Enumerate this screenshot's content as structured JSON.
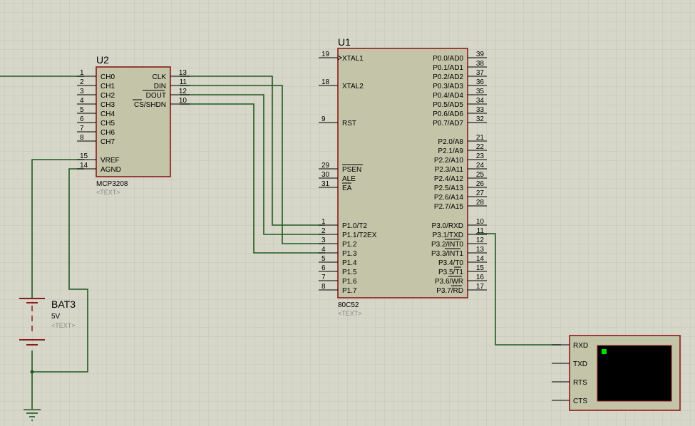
{
  "colors": {
    "background": "#d7d7c9",
    "grid": "#c6c6b8",
    "component_fill": "#c4c4a8",
    "component_border": "#8b1c1c",
    "wire": "#1f5a1f",
    "terminal_screen": "#000000",
    "terminal_led": "#00e000"
  },
  "u2": {
    "ref": "U2",
    "part": "MCP3208",
    "text_placeholder": "<TEXT>",
    "left_pins": [
      {
        "num": "1",
        "name": "CH0"
      },
      {
        "num": "2",
        "name": "CH1"
      },
      {
        "num": "3",
        "name": "CH2"
      },
      {
        "num": "4",
        "name": "CH3"
      },
      {
        "num": "5",
        "name": "CH4"
      },
      {
        "num": "6",
        "name": "CH5"
      },
      {
        "num": "7",
        "name": "CH6"
      },
      {
        "num": "8",
        "name": "CH7"
      },
      {
        "num": "15",
        "name": "VREF"
      },
      {
        "num": "14",
        "name": "AGND"
      }
    ],
    "right_pins": [
      {
        "num": "13",
        "name": "CLK"
      },
      {
        "num": "11",
        "name": "DIN"
      },
      {
        "num": "12",
        "name": "DOUT"
      },
      {
        "num": "10",
        "name": "CS/SHDN"
      }
    ]
  },
  "u1": {
    "ref": "U1",
    "part": "80C52",
    "text_placeholder": "<TEXT>",
    "left_pins": [
      {
        "num": "19",
        "name": "XTAL1"
      },
      {
        "num": "18",
        "name": "XTAL2"
      },
      {
        "num": "9",
        "name": "RST"
      },
      {
        "num": "29",
        "name": "PSEN"
      },
      {
        "num": "30",
        "name": "ALE"
      },
      {
        "num": "31",
        "name": "EA"
      },
      {
        "num": "1",
        "name": "P1.0/T2"
      },
      {
        "num": "2",
        "name": "P1.1/T2EX"
      },
      {
        "num": "3",
        "name": "P1.2"
      },
      {
        "num": "4",
        "name": "P1.3"
      },
      {
        "num": "5",
        "name": "P1.4"
      },
      {
        "num": "6",
        "name": "P1.5"
      },
      {
        "num": "7",
        "name": "P1.6"
      },
      {
        "num": "8",
        "name": "P1.7"
      }
    ],
    "right_pins": [
      {
        "num": "39",
        "name": "P0.0/AD0"
      },
      {
        "num": "38",
        "name": "P0.1/AD1"
      },
      {
        "num": "37",
        "name": "P0.2/AD2"
      },
      {
        "num": "36",
        "name": "P0.3/AD3"
      },
      {
        "num": "35",
        "name": "P0.4/AD4"
      },
      {
        "num": "34",
        "name": "P0.5/AD5"
      },
      {
        "num": "33",
        "name": "P0.6/AD6"
      },
      {
        "num": "32",
        "name": "P0.7/AD7"
      },
      {
        "num": "21",
        "name": "P2.0/A8"
      },
      {
        "num": "22",
        "name": "P2.1/A9"
      },
      {
        "num": "23",
        "name": "P2.2/A10"
      },
      {
        "num": "24",
        "name": "P2.3/A11"
      },
      {
        "num": "25",
        "name": "P2.4/A12"
      },
      {
        "num": "26",
        "name": "P2.5/A13"
      },
      {
        "num": "27",
        "name": "P2.6/A14"
      },
      {
        "num": "28",
        "name": "P2.7/A15"
      },
      {
        "num": "10",
        "name": "P3.0/RXD"
      },
      {
        "num": "11",
        "name": "P3.1/TXD"
      },
      {
        "num": "12",
        "name": "P3.2/INT0"
      },
      {
        "num": "13",
        "name": "P3.3/INT1"
      },
      {
        "num": "14",
        "name": "P3.4/T0"
      },
      {
        "num": "15",
        "name": "P3.5/T1"
      },
      {
        "num": "16",
        "name": "P3.6/WR"
      },
      {
        "num": "17",
        "name": "P3.7/RD"
      }
    ]
  },
  "battery": {
    "ref": "BAT3",
    "value": "5V",
    "text_placeholder": "<TEXT>"
  },
  "terminal": {
    "pins": [
      "RXD",
      "TXD",
      "RTS",
      "CTS"
    ]
  }
}
